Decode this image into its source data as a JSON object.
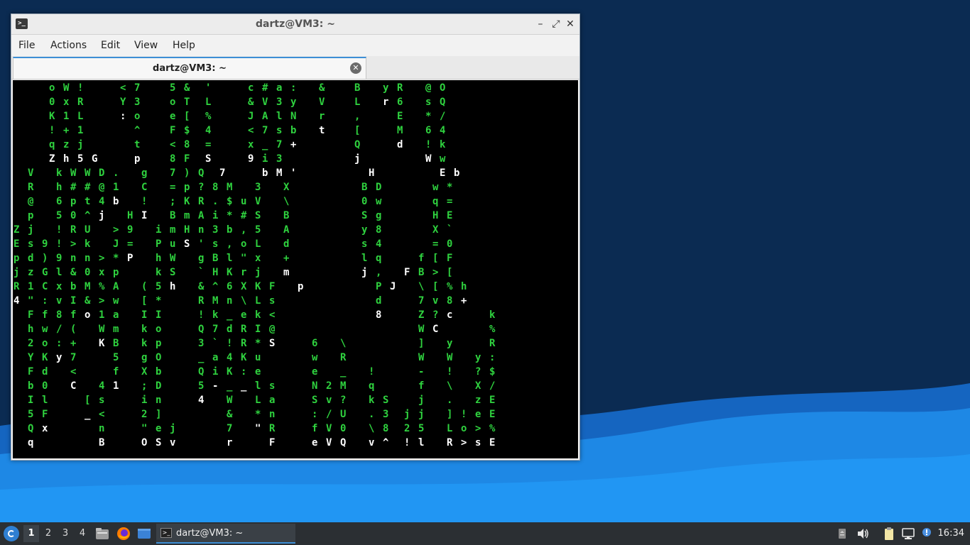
{
  "colors": {
    "desktop_top": "#0b2b52",
    "desktop_wave": "#1976d2",
    "matrix_green": "#2fd23f",
    "matrix_head": "#ffffff"
  },
  "window": {
    "title": "dartz@VM3: ~",
    "controls": {
      "minimize": "–",
      "maximize": "⤢",
      "close": "✕"
    },
    "menu": [
      "File",
      "Actions",
      "Edit",
      "View",
      "Help"
    ],
    "tab": {
      "label": "dartz@VM3: ~",
      "close": "✕"
    }
  },
  "terminal": {
    "rows": [
      "     o W !     < 7    5 &  '     c # a :   &    B   y R   @ O",
      "     0 x R     Y 3    o T  L     & V 3 y   V    L   r 6   s Q",
      "     K 1 L     : o    e [  %     J A l N   r    ,     E   * /",
      "     ! + 1       ^    F $  4     < 7 s b   t    [     M   6 4",
      "     q z j       t    < 8  =     x _ 7 +        Q     d   ! k",
      "     Z h 5 G     p    8 F  S     9 i 3          j         W w",
      "  V   k W W D .   g   7 ) Q  7     b M '          H         E b",
      "  R   h # # @ 1   C   = p ? 8 M   3   X          B D       w *",
      "  @   6 p t 4 b   !   ; K R . $ u V   \\          0 w       q =",
      "  p   5 0 ^ j   H I   B m A i * # S   B          S g       H E",
      "Z j   ! R U   > 9   i m H n 3 b , 5   A          y 8       X `",
      "E s 9 ! > k   J =   P u S ' s , o L   d          s 4       = 0",
      "p d ) 9 n n > * P   h W   g B l \" x   +          l q     f [ F",
      "j z G l & 0 x p     k S   ` H K r j   m          j ,   F B > [",
      "R 1 C x b M % A   ( 5 h   & ^ 6 X K F   p          P J   \\ [ % h",
      "4 \" : v I & > w   [ *     R M n \\ L s              d     7 v 8 +",
      "  F f 8 f o 1 a   I I     ! k _ e k <              8     Z ? c     k",
      "  h w / (   W m   k o     Q 7 d R I @                    W C       %",
      "  2 o : +   K B   k p     3 ` ! R * S     6   \\          ]   y     R",
      "  Y K y 7     5   g O     _ a 4 K u       w   R          W   W   y :",
      "  F d   <     f   X b     Q i K : e       e   _   !      -   !   ? $",
      "  b 0   C   4 1   ; D     5 - _ _ l s     N 2 M   q      f   \\   X /",
      "  I l     [ s     i n     4   W   L a     S v ?   k S    j   .   z E",
      "  5 F     _ <     2 ]         &   * n     : / U   . 3  j j   ] ! e E",
      "  Q x       n     \" e j       7   \" R     f V 0   \\ 8  2 5   L o > %",
      "  q         B     O S v       r     F     e V Q   v ^  ! l   R > s E"
    ]
  },
  "taskbar": {
    "workspaces": [
      "1",
      "2",
      "3",
      "4"
    ],
    "task_label": "dartz@VM3: ~",
    "clock": "16:34"
  }
}
